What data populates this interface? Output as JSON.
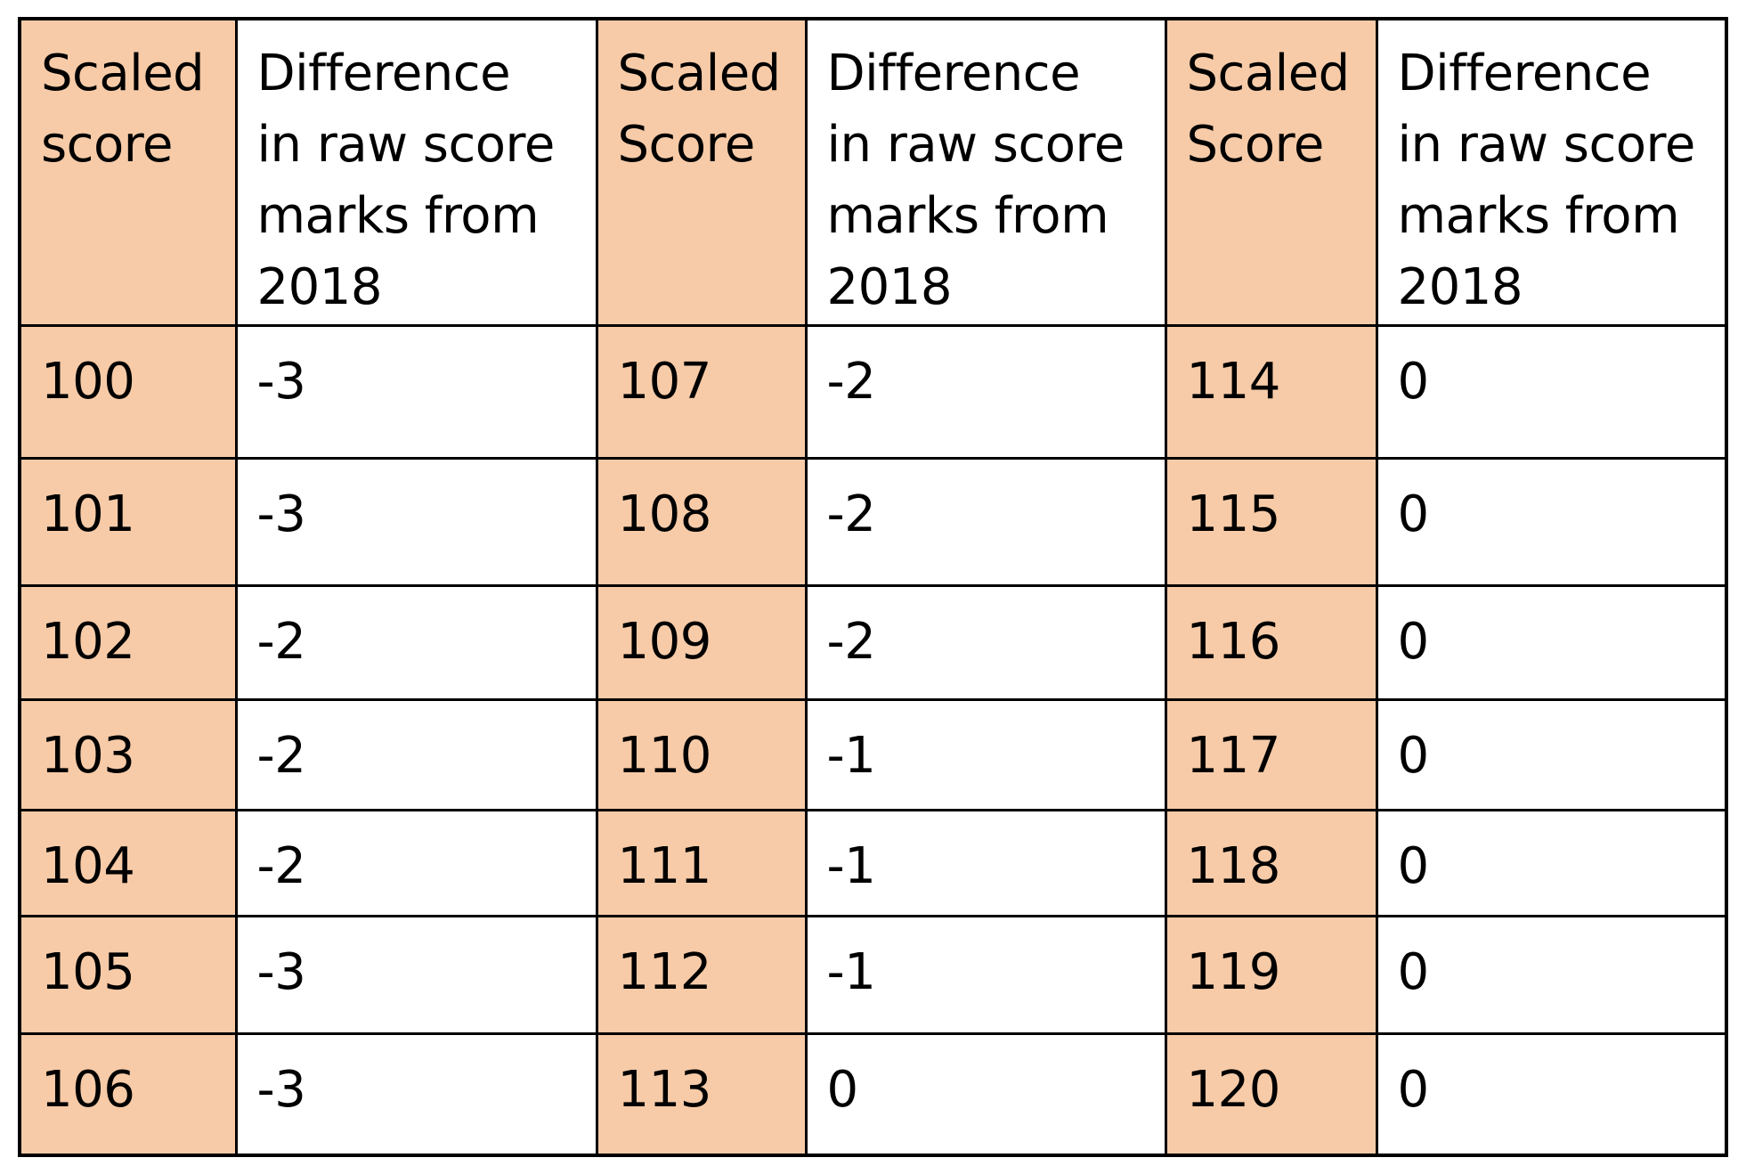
{
  "table": {
    "colors": {
      "scaled_fill": "#F7CBA8",
      "diff_fill": "#FFFFFF",
      "border": "#000000"
    },
    "headers": [
      {
        "lines": [
          "Scaled",
          "score"
        ]
      },
      {
        "lines": [
          "Difference",
          "in raw score",
          "marks from",
          "2018"
        ]
      },
      {
        "lines": [
          "Scaled",
          "Score"
        ]
      },
      {
        "lines": [
          "Difference",
          "in raw score",
          "marks from",
          "2018"
        ]
      },
      {
        "lines": [
          "Scaled",
          "Score"
        ]
      },
      {
        "lines": [
          "Difference",
          "in raw score",
          "marks from",
          "2018"
        ]
      }
    ],
    "rows": [
      [
        "100",
        "-3",
        "107",
        "-2",
        "114",
        "0"
      ],
      [
        "101",
        "-3",
        "108",
        "-2",
        "115",
        "0"
      ],
      [
        "102",
        "-2",
        "109",
        "-2",
        "116",
        "0"
      ],
      [
        "103",
        "-2",
        "110",
        "-1",
        "117",
        "0"
      ],
      [
        "104",
        "-2",
        "111",
        "-1",
        "118",
        "0"
      ],
      [
        "105",
        "-3",
        "112",
        "-1",
        "119",
        "0"
      ],
      [
        "106",
        "-3",
        "113",
        "0",
        "120",
        "0"
      ]
    ]
  }
}
